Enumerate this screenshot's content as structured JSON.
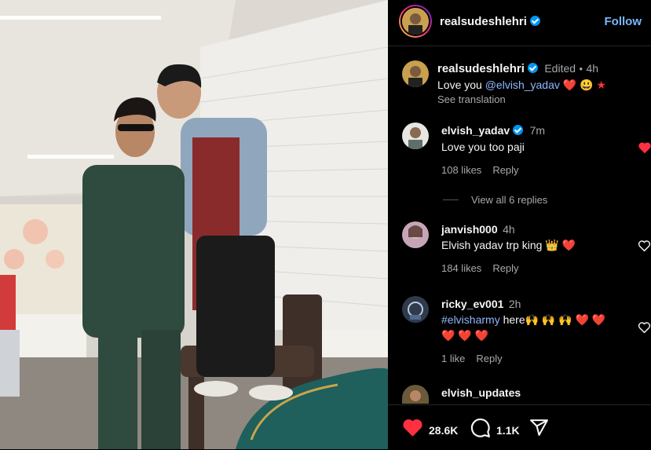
{
  "header": {
    "username": "realsudeshlehri",
    "follow_label": "Follow"
  },
  "caption": {
    "username": "realsudeshlehri",
    "edited": "Edited",
    "dot": "•",
    "time": "4h",
    "text_before": "Love you ",
    "mention": "@elvish_yadav",
    "emojis": "❤️ 😃 ★",
    "see_translation": "See translation"
  },
  "comments": [
    {
      "username": "elvish_yadav",
      "time": "7m",
      "text": "Love you too paji",
      "likes": "108 likes",
      "reply": "Reply",
      "verified": true
    },
    {
      "username": "janvish000",
      "time": "4h",
      "text": "Elvish yadav trp king 👑 ❤️",
      "likes": "184 likes",
      "reply": "Reply"
    },
    {
      "username": "ricky_ev001",
      "time": "2h",
      "hashtag": "#elvisharmy",
      "text_after": " here🙌 🙌 🙌 ❤️ ❤️",
      "text_line2": "❤️ ❤️ ❤️",
      "likes": "1 like",
      "reply": "Reply"
    },
    {
      "username": "elvish_updates"
    }
  ],
  "view_replies": "View all 6 replies",
  "actions": {
    "likes_count": "28.6K",
    "comments_count": "1.1K"
  },
  "colors": {
    "accent": "#0095f6",
    "like_red": "#ff3040",
    "link": "#8fb8ff"
  }
}
